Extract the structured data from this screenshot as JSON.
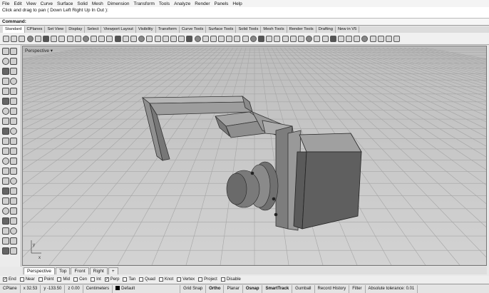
{
  "menu": [
    "File",
    "Edit",
    "View",
    "Curve",
    "Surface",
    "Solid",
    "Mesh",
    "Dimension",
    "Transform",
    "Tools",
    "Analyze",
    "Render",
    "Panels",
    "Help"
  ],
  "history": {
    "line1": "Click and drag to pan ( Down  Left  Right  Up  In  Out ):"
  },
  "command": {
    "label": "Command:"
  },
  "toolbar_tabs": [
    "Standard",
    "CPlanes",
    "Set View",
    "Display",
    "Select",
    "Viewport Layout",
    "Visibility",
    "Transform",
    "Curve Tools",
    "Surface Tools",
    "Solid Tools",
    "Mesh Tools",
    "Render Tools",
    "Drafting",
    "New in V5"
  ],
  "viewport": {
    "title": "Perspective",
    "axis_x": "x",
    "axis_y": "y"
  },
  "view_tabs": [
    "Perspective",
    "Top",
    "Front",
    "Right"
  ],
  "osnaps": [
    {
      "label": "End",
      "checked": true
    },
    {
      "label": "Near",
      "checked": false
    },
    {
      "label": "Point",
      "checked": false
    },
    {
      "label": "Mid",
      "checked": false
    },
    {
      "label": "Cen",
      "checked": false
    },
    {
      "label": "Int",
      "checked": false
    },
    {
      "label": "Perp",
      "checked": true
    },
    {
      "label": "Tan",
      "checked": false
    },
    {
      "label": "Quad",
      "checked": false
    },
    {
      "label": "Knot",
      "checked": false
    },
    {
      "label": "Vertex",
      "checked": false
    },
    {
      "label": "Project",
      "checked": false
    },
    {
      "label": "Disable",
      "checked": false
    }
  ],
  "status": {
    "cplane": "CPlane",
    "x": "x 32.53",
    "y": "y -133.50",
    "z": "z 0.00",
    "units": "Centimeters",
    "layer": "Default",
    "grid_snap": "Grid Snap",
    "ortho": "Ortho",
    "planar": "Planar",
    "osnap": "Osnap",
    "smarttrack": "SmartTrack",
    "gumball": "Gumball",
    "record_history": "Record History",
    "filter": "Filter",
    "tolerance": "Absolute tolerance: 0.01"
  },
  "colors": {
    "viewport_bg": "#c9c9c9",
    "grid": "#a8a8a8",
    "model": "#555555"
  }
}
